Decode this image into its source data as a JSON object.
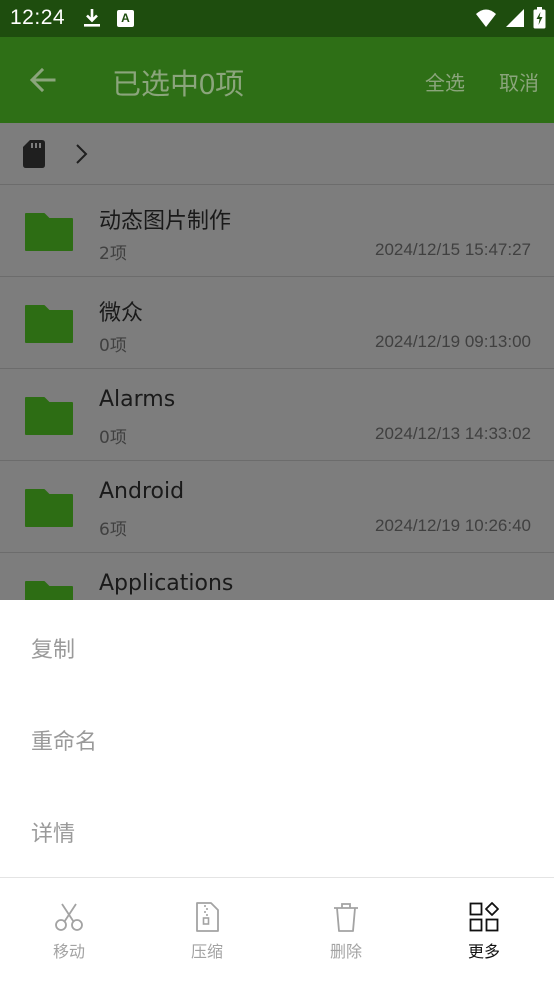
{
  "status_bar": {
    "time": "12:24",
    "notif_icon_letter": "A"
  },
  "app_bar": {
    "title": "已选中0项",
    "select_all": "全选",
    "cancel": "取消"
  },
  "colors": {
    "status_bar": "#1e4d0e",
    "app_bar": "#2e6f16",
    "folder": "#2d6d14",
    "dim_overlay": "#7d7d7d"
  },
  "breadcrumb": {
    "root_icon": "sd-card-icon",
    "separator_icon": "chevron-right-icon"
  },
  "files": [
    {
      "name": "动态图片制作",
      "count": "2项",
      "time": "2024/12/15 15:47:27"
    },
    {
      "name": "微众",
      "count": "0项",
      "time": "2024/12/19 09:13:00"
    },
    {
      "name": "Alarms",
      "count": "0项",
      "time": "2024/12/13 14:33:02"
    },
    {
      "name": "Android",
      "count": "6项",
      "time": "2024/12/19 10:26:40"
    },
    {
      "name": "Applications",
      "count": "",
      "time": ""
    }
  ],
  "sheet_menu": [
    {
      "label": "复制"
    },
    {
      "label": "重命名"
    },
    {
      "label": "详情"
    }
  ],
  "toolbar": [
    {
      "label": "移动",
      "icon": "scissors-icon"
    },
    {
      "label": "压缩",
      "icon": "zip-file-icon"
    },
    {
      "label": "删除",
      "icon": "trash-icon"
    },
    {
      "label": "更多",
      "icon": "grid-more-icon"
    }
  ]
}
